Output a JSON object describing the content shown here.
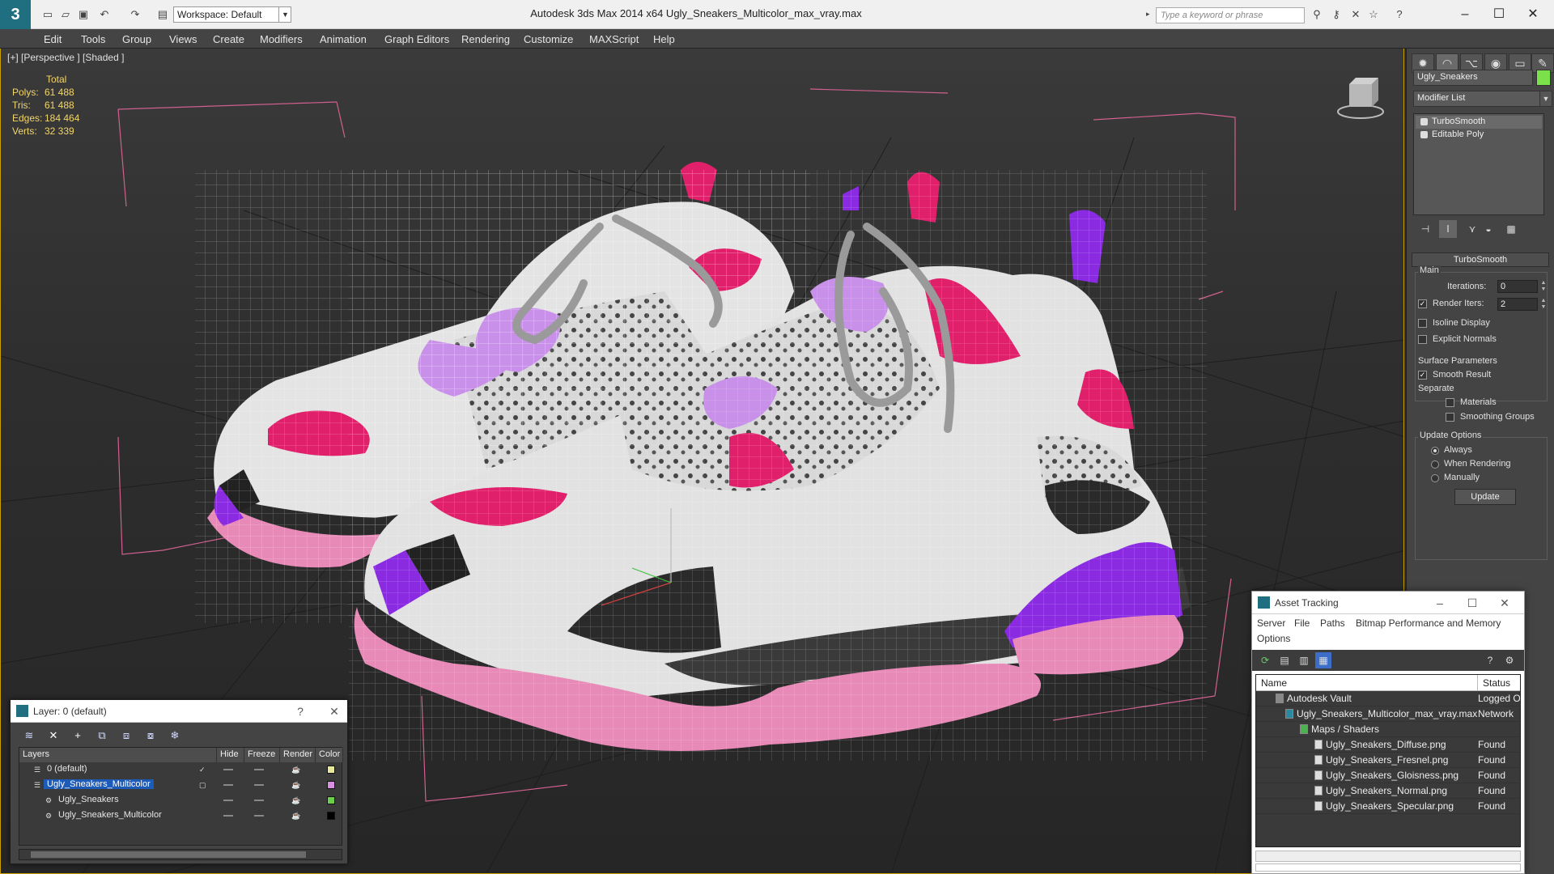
{
  "title_bar": {
    "workspace": "Workspace: Default",
    "title": "Autodesk 3ds Max  2014 x64     Ugly_Sneakers_Multicolor_max_vray.max",
    "search_placeholder": "Type a keyword or phrase"
  },
  "menu": [
    "Edit",
    "Tools",
    "Group",
    "Views",
    "Create",
    "Modifiers",
    "Animation",
    "Graph Editors",
    "Rendering",
    "Customize",
    "MAXScript",
    "Help"
  ],
  "viewport": {
    "label": "[+] [Perspective ] [Shaded ]",
    "stats": {
      "header": "Total",
      "rows": [
        {
          "label": "Polys:",
          "value": "61 488"
        },
        {
          "label": "Tris:",
          "value": "61 488"
        },
        {
          "label": "Edges:",
          "value": "184 464"
        },
        {
          "label": "Verts:",
          "value": "32 339"
        }
      ]
    },
    "colors": {
      "selection": "#d05a8a",
      "pink": "#e88ab8",
      "magenta": "#e0206a",
      "lilac": "#c890e8",
      "purple": "#8a2be2"
    }
  },
  "command_panel": {
    "object_name": "Ugly_Sneakers",
    "modifier_list": "Modifier List",
    "stack": [
      "TurboSmooth",
      "Editable Poly"
    ],
    "rollout_title": "TurboSmooth",
    "main_label": "Main",
    "iterations_label": "Iterations:",
    "iterations_value": "0",
    "render_iters_label": "Render Iters:",
    "render_iters_value": "2",
    "isoline_label": "Isoline Display",
    "explicit_label": "Explicit Normals",
    "surface_label": "Surface Parameters",
    "smooth_result_label": "Smooth Result",
    "separate_label": "Separate",
    "materials_label": "Materials",
    "smoothing_groups_label": "Smoothing Groups",
    "update_options_label": "Update Options",
    "always_label": "Always",
    "when_rendering_label": "When Rendering",
    "manually_label": "Manually",
    "update_button": "Update"
  },
  "layer_window": {
    "title": "Layer: 0 (default)",
    "headers": [
      "Layers",
      "Hide",
      "Freeze",
      "Render",
      "Color"
    ],
    "rows": [
      {
        "name": "0 (default)",
        "color": "#e8e89a"
      },
      {
        "name": "Ugly_Sneakers_Multicolor",
        "color": "#d890e0"
      },
      {
        "name": "Ugly_Sneakers",
        "color": "#6ad04a"
      },
      {
        "name": "Ugly_Sneakers_Multicolor",
        "color": "#000000"
      }
    ]
  },
  "asset_window": {
    "title": "Asset Tracking",
    "menu": [
      "Server",
      "File",
      "Paths",
      "Bitmap Performance and Memory",
      "Options"
    ],
    "headers": [
      "Name",
      "Status"
    ],
    "rows": [
      {
        "name": "Autodesk Vault",
        "status": "Logged O"
      },
      {
        "name": "Ugly_Sneakers_Multicolor_max_vray.max",
        "status": "Network"
      },
      {
        "name": "Maps / Shaders",
        "status": ""
      },
      {
        "name": "Ugly_Sneakers_Diffuse.png",
        "status": "Found"
      },
      {
        "name": "Ugly_Sneakers_Fresnel.png",
        "status": "Found"
      },
      {
        "name": "Ugly_Sneakers_Gloisness.png",
        "status": "Found"
      },
      {
        "name": "Ugly_Sneakers_Normal.png",
        "status": "Found"
      },
      {
        "name": "Ugly_Sneakers_Specular.png",
        "status": "Found"
      }
    ]
  }
}
